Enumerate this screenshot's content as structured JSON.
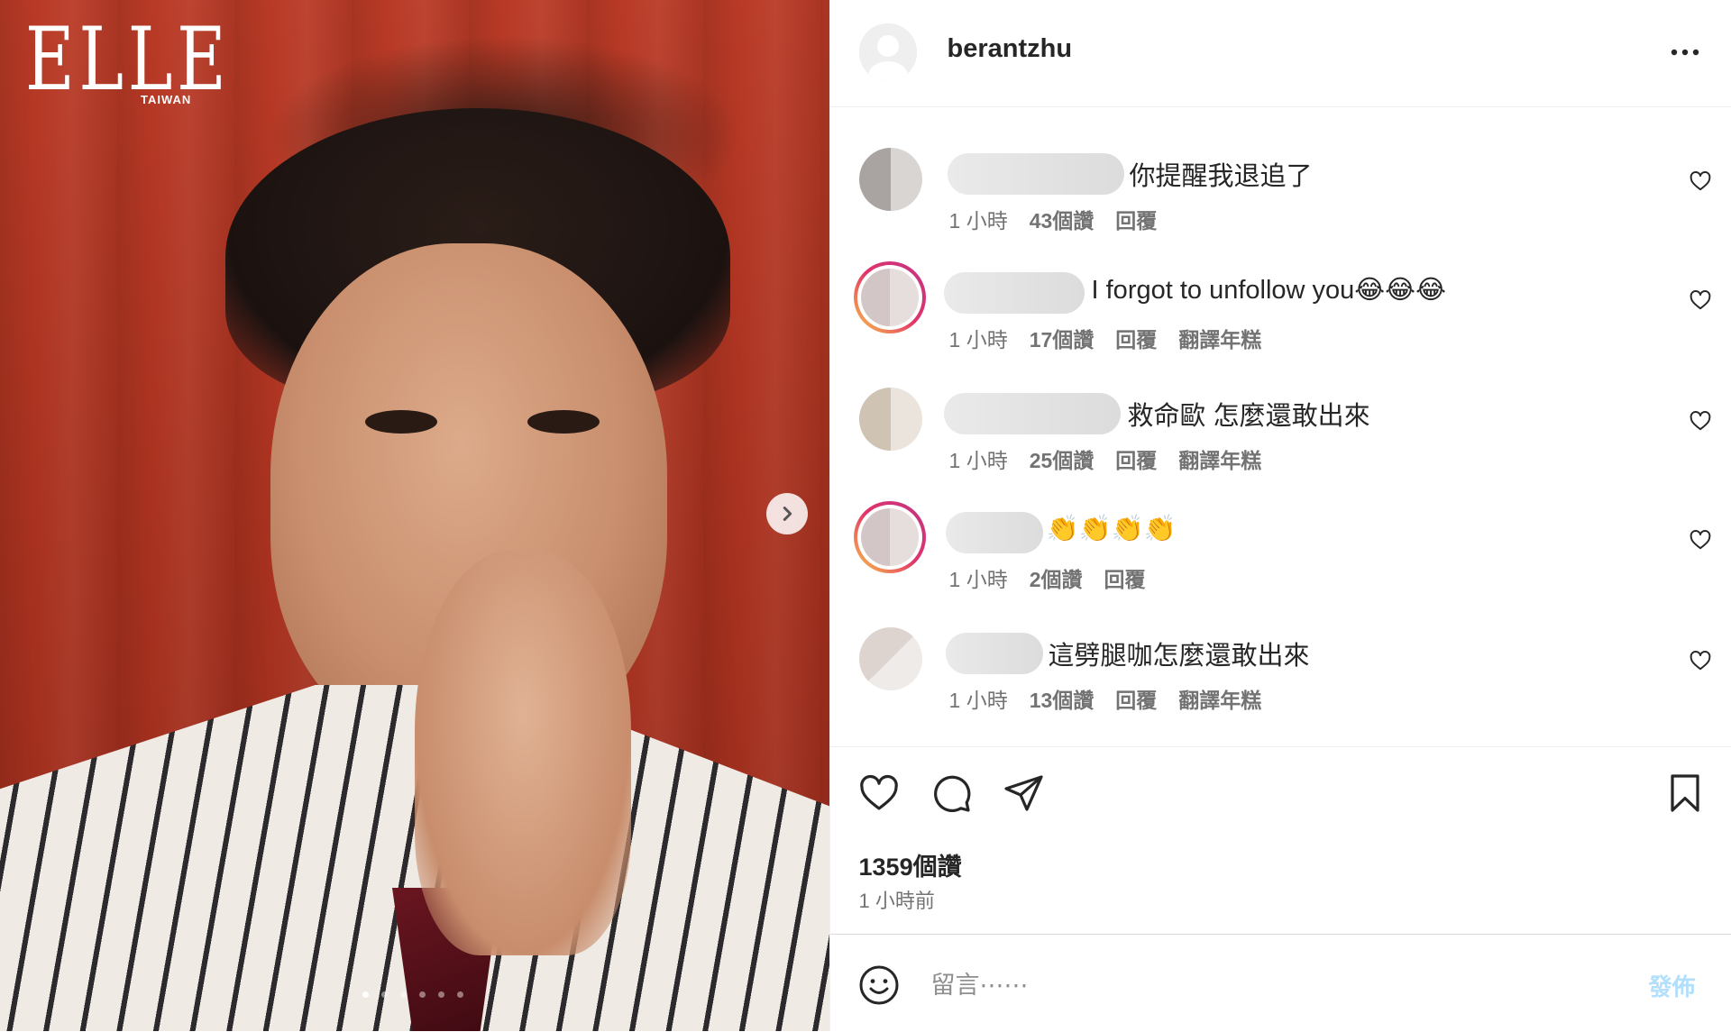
{
  "media": {
    "logo": "ELLE",
    "logo_sub": "TAIWAN",
    "carousel_count": 6,
    "carousel_active_index": 0
  },
  "post": {
    "username": "berantzhu",
    "likes": "1359個讚",
    "posted_time": "1 小時前"
  },
  "comments": [
    {
      "text": "你提醒我退追了",
      "time": "1 小時",
      "likes": "43個讚",
      "reply": "回覆",
      "translate": ""
    },
    {
      "text": "I forgot to unfollow you😂😂😂",
      "time": "1 小時",
      "likes": "17個讚",
      "reply": "回覆",
      "translate": "翻譯年糕"
    },
    {
      "text": "救命歐 怎麼還敢出來",
      "time": "1 小時",
      "likes": "25個讚",
      "reply": "回覆",
      "translate": "翻譯年糕"
    },
    {
      "text": "👏👏👏👏",
      "time": "1 小時",
      "likes": "2個讚",
      "reply": "回覆",
      "translate": ""
    },
    {
      "text": "這劈腿咖怎麼還敢出來",
      "time": "1 小時",
      "likes": "13個讚",
      "reply": "回覆",
      "translate": "翻譯年糕"
    }
  ],
  "composer": {
    "placeholder": "留言⋯⋯",
    "post_label": "發佈"
  },
  "icons": {
    "carousel_next": "chevron-right-icon",
    "more": "more-horizontal-icon",
    "like": "heart-icon",
    "comment": "comment-icon",
    "share": "send-icon",
    "save": "bookmark-icon",
    "emoji": "smiley-icon"
  },
  "colors": {
    "text": "#262626",
    "secondary": "#737373",
    "divider": "#efefef",
    "post_button_disabled": "#b2dffc",
    "story_ring_start": "#f9c846",
    "story_ring_end": "#c13584"
  }
}
